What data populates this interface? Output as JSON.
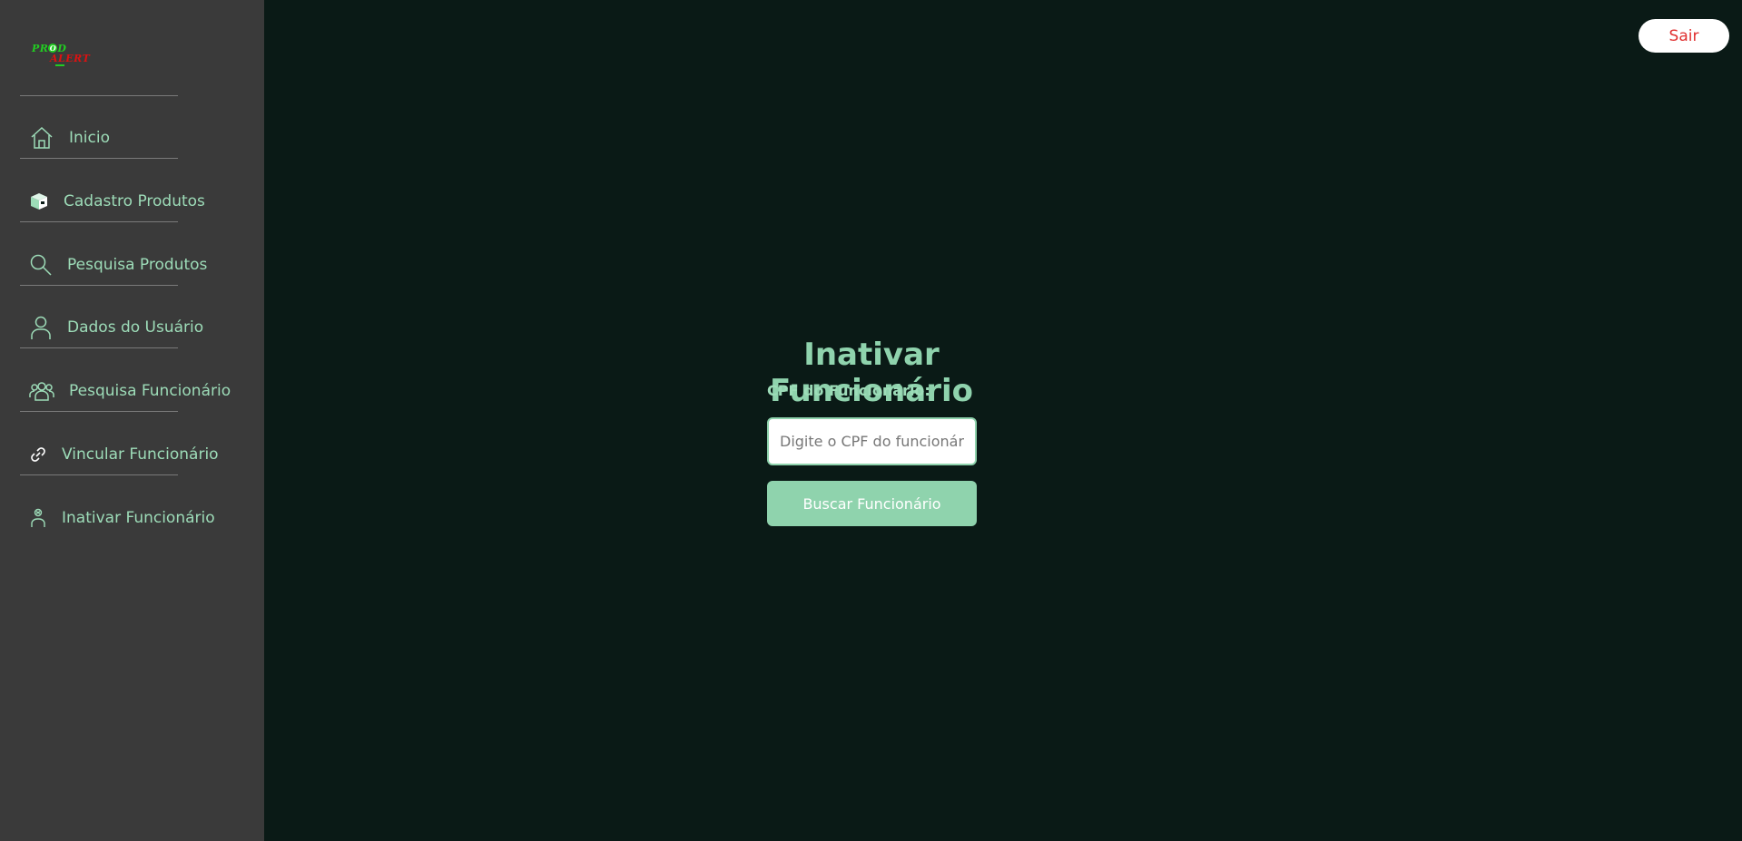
{
  "logo": {
    "line1_start": "PR",
    "line1_o": "O",
    "line1_end": "D",
    "line2": "ALERT"
  },
  "sidebar": {
    "items": [
      {
        "label": "Inicio",
        "icon": "home-icon"
      },
      {
        "label": "Cadastro Produtos",
        "icon": "box-icon"
      },
      {
        "label": "Pesquisa Produtos",
        "icon": "search-icon"
      },
      {
        "label": "Dados do Usuário",
        "icon": "user-icon"
      },
      {
        "label": "Pesquisa Funcionário",
        "icon": "group-icon"
      },
      {
        "label": "Vincular Funcionário",
        "icon": "link-icon"
      },
      {
        "label": "Inativar Funcionário",
        "icon": "user-remove-icon"
      }
    ]
  },
  "header": {
    "logout_label": "Sair"
  },
  "main": {
    "title": "Inativar Funcionário",
    "cpf_label": "CPF do Funcionário:",
    "cpf_placeholder": "Digite o CPF do funcionário",
    "cpf_value": "",
    "search_button_label": "Buscar Funcionário"
  },
  "colors": {
    "background": "#0a1a16",
    "sidebar": "#3a3a3a",
    "accent": "#8fd3ad",
    "logout_text": "#e03030"
  }
}
